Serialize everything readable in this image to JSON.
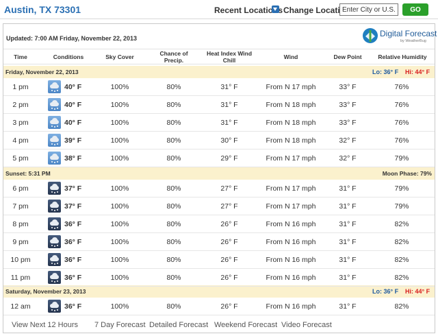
{
  "header": {
    "city": "Austin, TX 73301",
    "recent_locations": "Recent Locations",
    "change_location": "Change Location",
    "zip_value": "Enter City or U.S. ZIP",
    "go": "GO"
  },
  "forecast": {
    "updated": "Updated: 7:00 AM Friday, November 22, 2013",
    "brand_name": "Digital Forecast",
    "brand_sub": "by WeatherBug",
    "columns": {
      "time": "Time",
      "conditions": "Conditions",
      "sky": "Sky Cover",
      "precip": "Chance of Precip.",
      "heat": "Heat Index Wind Chill",
      "wind": "Wind",
      "dew": "Dew Point",
      "humidity": "Relative Humidity"
    },
    "day1": {
      "label": "Friday, November 22, 2013",
      "lo": "Lo: 36° F",
      "hi": "Hi: 44° F"
    },
    "sunset": {
      "label": "Sunset: 5:31 PM",
      "moon": "Moon Phase: 79%"
    },
    "day2": {
      "label": "Saturday, November 23, 2013",
      "lo": "Lo: 36° F",
      "hi": "Hi: 44° F"
    },
    "rows": [
      {
        "time": "1 pm",
        "temp": "40° F",
        "sky": "100%",
        "precip": "80%",
        "heat": "31° F",
        "wind": "From N 17 mph",
        "dew": "33° F",
        "rh": "76%",
        "icon": "day-rain-icon"
      },
      {
        "time": "2 pm",
        "temp": "40° F",
        "sky": "100%",
        "precip": "80%",
        "heat": "31° F",
        "wind": "From N 18 mph",
        "dew": "33° F",
        "rh": "76%",
        "icon": "day-rain-icon"
      },
      {
        "time": "3 pm",
        "temp": "40° F",
        "sky": "100%",
        "precip": "80%",
        "heat": "31° F",
        "wind": "From N 18 mph",
        "dew": "33° F",
        "rh": "76%",
        "icon": "day-rain-icon"
      },
      {
        "time": "4 pm",
        "temp": "39° F",
        "sky": "100%",
        "precip": "80%",
        "heat": "30° F",
        "wind": "From N 18 mph",
        "dew": "32° F",
        "rh": "76%",
        "icon": "day-rain-icon"
      },
      {
        "time": "5 pm",
        "temp": "38° F",
        "sky": "100%",
        "precip": "80%",
        "heat": "29° F",
        "wind": "From N 17 mph",
        "dew": "32° F",
        "rh": "79%",
        "icon": "day-rain-icon"
      },
      {
        "time": "6 pm",
        "temp": "37° F",
        "sky": "100%",
        "precip": "80%",
        "heat": "27° F",
        "wind": "From N 17 mph",
        "dew": "31° F",
        "rh": "79%",
        "icon": "night-rain-icon"
      },
      {
        "time": "7 pm",
        "temp": "37° F",
        "sky": "100%",
        "precip": "80%",
        "heat": "27° F",
        "wind": "From N 17 mph",
        "dew": "31° F",
        "rh": "79%",
        "icon": "night-rain-icon"
      },
      {
        "time": "8 pm",
        "temp": "36° F",
        "sky": "100%",
        "precip": "80%",
        "heat": "26° F",
        "wind": "From N 16 mph",
        "dew": "31° F",
        "rh": "82%",
        "icon": "night-rain-icon"
      },
      {
        "time": "9 pm",
        "temp": "36° F",
        "sky": "100%",
        "precip": "80%",
        "heat": "26° F",
        "wind": "From N 16 mph",
        "dew": "31° F",
        "rh": "82%",
        "icon": "night-rain-icon"
      },
      {
        "time": "10 pm",
        "temp": "36° F",
        "sky": "100%",
        "precip": "80%",
        "heat": "26° F",
        "wind": "From N 16 mph",
        "dew": "31° F",
        "rh": "82%",
        "icon": "night-rain-icon"
      },
      {
        "time": "11 pm",
        "temp": "36° F",
        "sky": "100%",
        "precip": "80%",
        "heat": "26° F",
        "wind": "From N 16 mph",
        "dew": "31° F",
        "rh": "82%",
        "icon": "night-rain-icon"
      },
      {
        "time": "12 am",
        "temp": "36° F",
        "sky": "100%",
        "precip": "80%",
        "heat": "26° F",
        "wind": "From N 16 mph",
        "dew": "31° F",
        "rh": "82%",
        "icon": "night-rain-icon"
      }
    ]
  },
  "links": {
    "next12": "View Next 12 Hours",
    "seven_day": "7 Day Forecast",
    "detailed": "Detailed Forecast",
    "weekend": "Weekend Forecast",
    "video": "Video Forecast"
  },
  "colors": {
    "band": "#fbf1cd",
    "lo": "#1e5aa0",
    "hi": "#d81f1f",
    "go": "#2ba02b",
    "city": "#2a6fb3"
  }
}
